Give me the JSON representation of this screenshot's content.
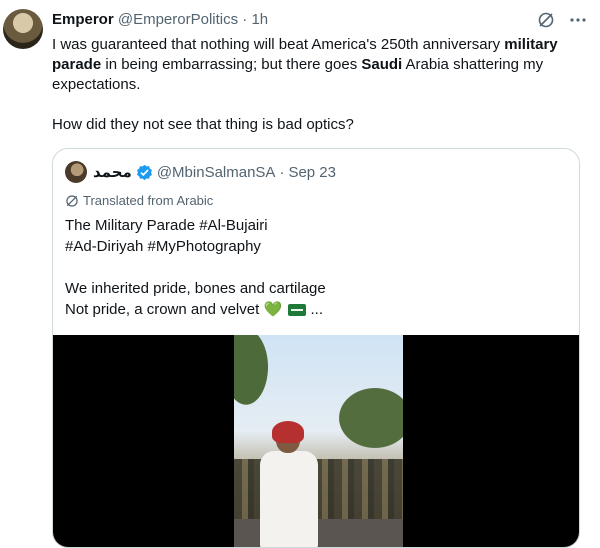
{
  "tweet": {
    "author_name": "Emperor",
    "author_handle": "@EmperorPolitics",
    "separator": "·",
    "time": "1h",
    "text_p1_a": "I was guaranteed that nothing will beat America's 250th anniversary ",
    "text_p1_bold1": "military parade",
    "text_p1_b": " in being embarrassing; but there goes ",
    "text_p1_bold2": "Saudi",
    "text_p1_c": " Arabia shattering my expectations.",
    "text_p2": "How did they not see that thing is bad optics?"
  },
  "quote": {
    "author_name": "محمد",
    "author_handle": "@MbinSalmanSA",
    "separator": "·",
    "date": "Sep 23",
    "translated_label": "Translated from Arabic",
    "line1": "The Military Parade #Al-Bujairi",
    "line2": "#Ad-Diriyah #MyPhotography",
    "line3": "We inherited pride, bones and cartilage",
    "line4": "Not pride, a crown and velvet",
    "line4_emoji": "💚",
    "line4_end": "..."
  },
  "icons": {
    "grok": "grok-slash-icon",
    "more": "more-dots-icon",
    "verified": "verified-badge-icon",
    "translate": "translate-icon"
  },
  "colors": {
    "text": "#0f1419",
    "muted": "#536471",
    "border": "#cfd9de",
    "verified": "#1d9bf0"
  }
}
